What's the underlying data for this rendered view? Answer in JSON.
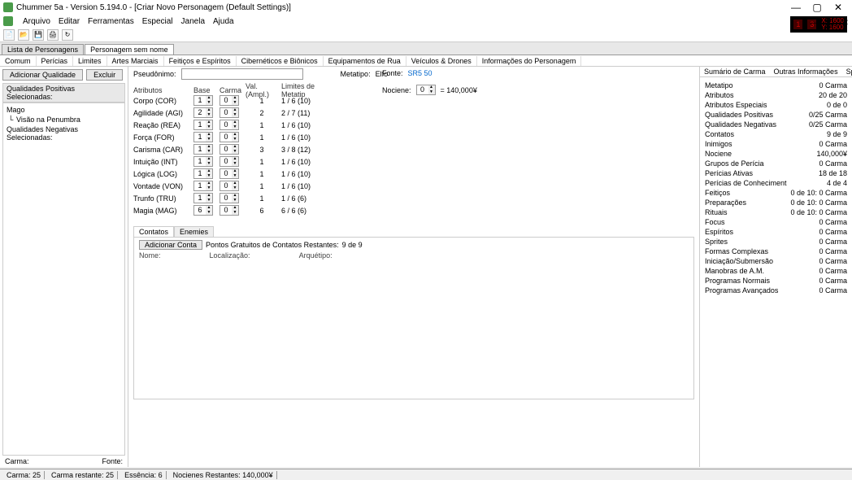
{
  "window": {
    "title": "Chummer 5a - Version 5.194.0 - [Criar Novo Personagem (Default Settings)]",
    "min": "—",
    "max": "▢",
    "close": "✕"
  },
  "menu": {
    "items": [
      "Arquivo",
      "Editar",
      "Ferramentas",
      "Especial",
      "Janela",
      "Ajuda"
    ]
  },
  "dice": {
    "d1": "1",
    "d2": "3",
    "line1": "X: 1600",
    "line2": "Y: 1600"
  },
  "doctabs": [
    "Lista de Personagens",
    "Personagem sem nome"
  ],
  "subtabs": [
    "Comum",
    "Perícias",
    "Limites",
    "Artes Marciais",
    "Feitiços e Espíritos",
    "Cibernéticos e Biônicos",
    "Equipamentos de Rua",
    "Veículos & Drones",
    "Informações do Personagem"
  ],
  "leftbuttons": {
    "add": "Adicionar Qualidade",
    "del": "Excluir"
  },
  "qual": {
    "poshdr": "Qualidades Positivas Selecionadas:",
    "tree": [
      {
        "label": "Mago",
        "child": false
      },
      {
        "label": "Visão na Penumbra",
        "child": true
      }
    ],
    "neghdr": "Qualidades Negativas Selecionadas:"
  },
  "lfooter": {
    "carma": "Carma:",
    "fonte": "Fonte:"
  },
  "top": {
    "pseud": "Pseudônimo:",
    "metatipo": "Metatipo:",
    "metaval": "Elfo"
  },
  "attrhdr": {
    "name": "Atributos",
    "base": "Base",
    "carma": "Carma",
    "val": "Val. (Ampl.)",
    "limits": "Limites de Metatip"
  },
  "attrs": [
    {
      "name": "Corpo (COR)",
      "base": "1",
      "carma": "0",
      "val": "1",
      "lim": "1 / 6 (10)"
    },
    {
      "name": "Agilidade (AGI)",
      "base": "2",
      "carma": "0",
      "val": "2",
      "lim": "2 / 7 (11)"
    },
    {
      "name": "Reação (REA)",
      "base": "1",
      "carma": "0",
      "val": "1",
      "lim": "1 / 6 (10)"
    },
    {
      "name": "Força (FOR)",
      "base": "1",
      "carma": "0",
      "val": "1",
      "lim": "1 / 6 (10)"
    },
    {
      "name": "Carisma (CAR)",
      "base": "1",
      "carma": "0",
      "val": "3",
      "lim": "3 / 8 (12)"
    },
    {
      "name": "Intuição (INT)",
      "base": "1",
      "carma": "0",
      "val": "1",
      "lim": "1 / 6 (10)"
    },
    {
      "name": "Lógica (LOG)",
      "base": "1",
      "carma": "0",
      "val": "1",
      "lim": "1 / 6 (10)"
    },
    {
      "name": "Vontade (VON)",
      "base": "1",
      "carma": "0",
      "val": "1",
      "lim": "1 / 6 (10)"
    },
    {
      "name": "Trunfo (TRU)",
      "base": "1",
      "carma": "0",
      "val": "1",
      "lim": "1 / 6 (6)"
    },
    {
      "name": "Magia (MAG)",
      "base": "6",
      "carma": "0",
      "val": "6",
      "lim": "6 / 6 (6)"
    }
  ],
  "meta": {
    "fonte": "Fonte:",
    "fonteval": "SR5 50",
    "noc": "Nociene:",
    "nocval": "0",
    "eq": "= 140,000¥"
  },
  "contacts": {
    "tabs": [
      "Contatos",
      "Enemies"
    ],
    "btns": [
      "Adicionar Conta",
      "Pontos Gratuitos de Contatos Restantes:"
    ],
    "rem": "9 de 9",
    "cols": [
      "Nome:",
      "Localização:",
      "Arquétipo:"
    ]
  },
  "right": {
    "tabs": [
      "Sumário de Carma",
      "Outras Informações",
      "Spell Defence"
    ],
    "rows": [
      [
        "Metatipo",
        "0 Carma"
      ],
      [
        "Atributos",
        "20 de 20"
      ],
      [
        "Atributos Especiais",
        "0 de 0"
      ],
      [
        "Qualidades Positivas",
        "0/25 Carma"
      ],
      [
        "Qualidades Negativas",
        "0/25 Carma"
      ],
      [
        "Contatos",
        "9 de 9"
      ],
      [
        "Inimigos",
        "0 Carma"
      ],
      [
        "Nociene",
        "140,000¥"
      ],
      [
        "Grupos de Perícia",
        "0 Carma"
      ],
      [
        "Perícias Ativas",
        "18 de 18"
      ],
      [
        "Perícias de Conheciment",
        "4 de 4"
      ],
      [
        "Feitiços",
        "0 de 10: 0 Carma"
      ],
      [
        "Preparações",
        "0 de 10: 0 Carma"
      ],
      [
        "Rituais",
        "0 de 10: 0 Carma"
      ],
      [
        "Focus",
        "0 Carma"
      ],
      [
        "Espíritos",
        "0 Carma"
      ],
      [
        "Sprites",
        "0 Carma"
      ],
      [
        "Formas Complexas",
        "0 Carma"
      ],
      [
        "Iniciação/Submersão",
        "0 Carma"
      ],
      [
        "Manobras de A.M.",
        "0 Carma"
      ],
      [
        "Programas Normais",
        "0 Carma"
      ],
      [
        "Programas Avançados",
        "0 Carma"
      ]
    ]
  },
  "status": {
    "carma": "Carma:  25",
    "carmarest": "Carma restante:  25",
    "ess": "Essência:  6",
    "noc": "Nocienes Restantes:   140,000¥"
  }
}
